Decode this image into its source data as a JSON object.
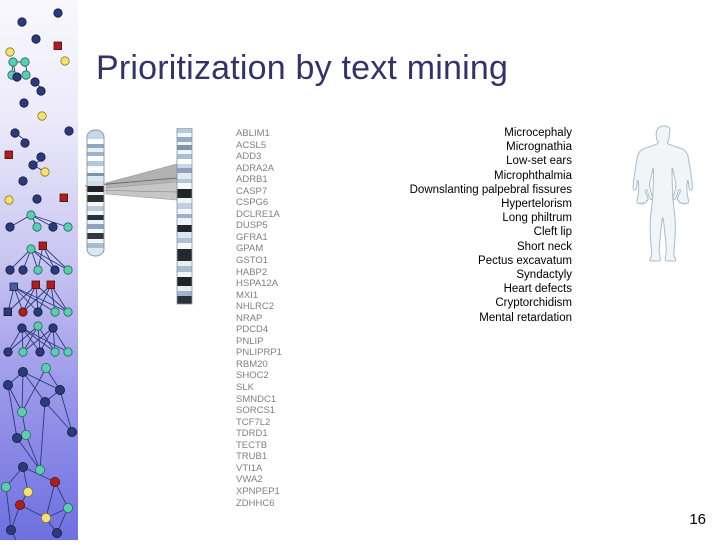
{
  "slide": {
    "title": "Prioritization by text mining",
    "page_number": "16",
    "title_color": "#333366"
  },
  "sidebar": {
    "name": "network-graph-decoration",
    "gradient_top": "#f7f7fd",
    "gradient_bottom": "#6f6fe0",
    "node_colors": [
      "#2b3a7a",
      "#5fcbb0",
      "#c21f1f",
      "#f5e07a"
    ],
    "edge_color": "#2b3a7a"
  },
  "ideogram": {
    "whole_chromosome_label": "",
    "zoom_region_label": "",
    "band_colors": [
      "#ffffff",
      "#c9d7e6",
      "#9fb4cb",
      "#5d6d7e",
      "#2b3138",
      "#000000"
    ],
    "outline_color": "#8a939c",
    "connector_fill": "#b8b8b8"
  },
  "genes": {
    "color": "#808080",
    "items": [
      "ABLIM1",
      "ACSL5",
      "ADD3",
      "ADRA2A",
      "ADRB1",
      "CASP7",
      "CSPG6",
      "DCLRE1A",
      "DUSP5",
      "GFRA1",
      "GPAM",
      "GSTO1",
      "HABP2",
      "HSPA12A",
      "MXI1",
      "NHLRC2",
      "NRAP",
      "PDCD4",
      "PNLIP",
      "PNLIPRP1",
      "RBM20",
      "SHOC2",
      "SLK",
      "SMNDC1",
      "SORCS1",
      "TCF7L2",
      "TDRD1",
      "TECTB",
      "TRUB1",
      "VTI1A",
      "VWA2",
      "XPNPEP1",
      "ZDHHC6"
    ]
  },
  "phenotypes": {
    "color": "#000000",
    "items": [
      "Microcephaly",
      "Micrognathia",
      "Low-set ears",
      "Microphthalmia",
      "Downslanting palpebral fissures",
      "Hypertelorism",
      "Long philtrum",
      "Cleft lip",
      "Short neck",
      "Pectus excavatum",
      "Syndactyly",
      "Heart defects",
      "Cryptorchidism",
      "Mental retardation"
    ]
  },
  "body_figure": {
    "name": "human-body-silhouette",
    "fill": "#f2f5f7",
    "stroke": "#a8bcc9"
  }
}
